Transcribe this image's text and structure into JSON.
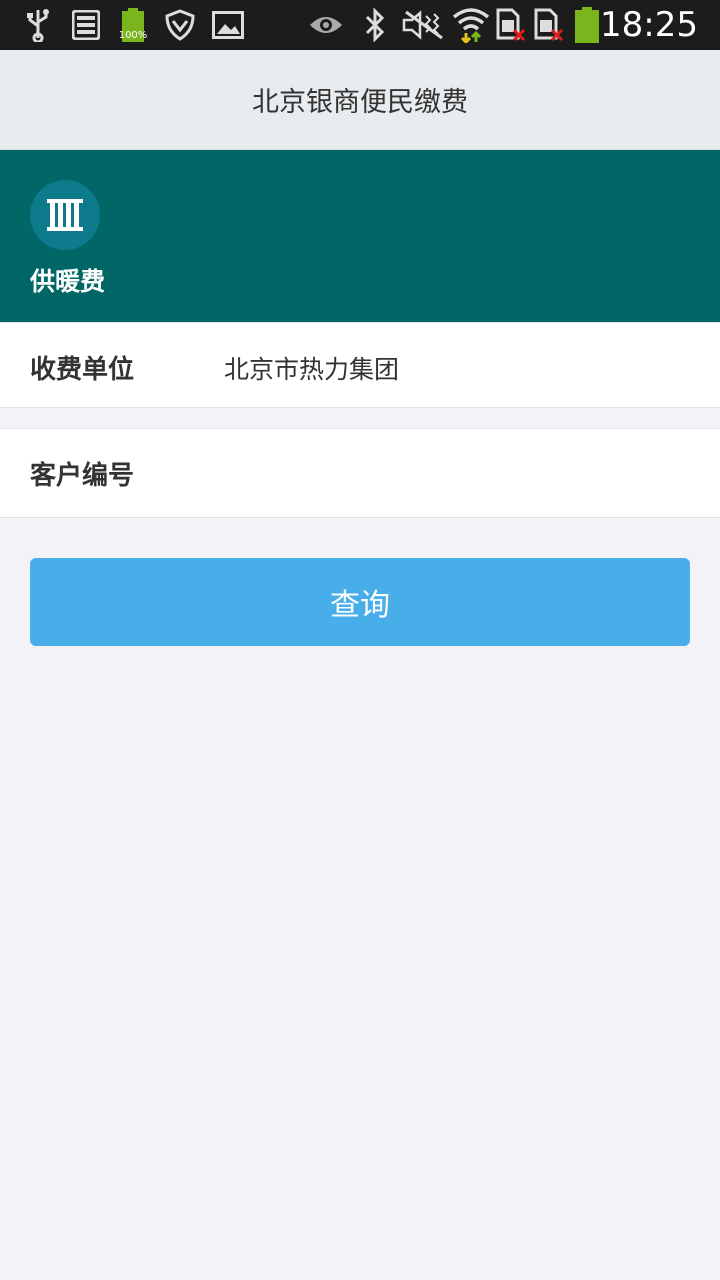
{
  "status_bar": {
    "battery_small_label": "100%",
    "time": "18:25",
    "icons": [
      "usb-icon",
      "storage-icon",
      "battery-small-icon",
      "shield-icon",
      "image-icon",
      "eye-icon",
      "bluetooth-icon",
      "mute-icon",
      "wifi-icon",
      "sim1-icon",
      "sim2-icon",
      "battery-icon"
    ],
    "battery_color": "#7ab51d"
  },
  "header": {
    "title": "北京银商便民缴费"
  },
  "banner": {
    "icon": "radiator-icon",
    "label": "供暖费",
    "background": "#016666",
    "icon_bg": "#0d7b8c"
  },
  "form": {
    "billing_unit_label": "收费单位",
    "billing_unit_value": "北京市热力集团",
    "customer_no_label": "客户编号",
    "customer_no_value": "",
    "customer_no_placeholder": ""
  },
  "actions": {
    "query_label": "查询",
    "button_color": "#48aeea"
  }
}
